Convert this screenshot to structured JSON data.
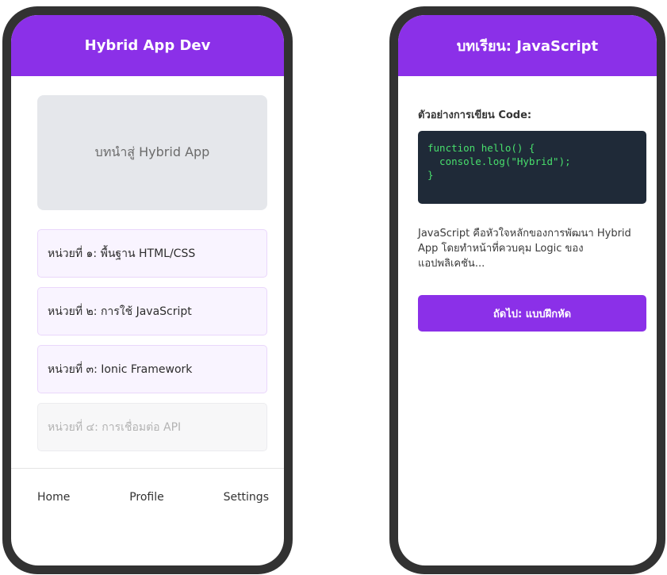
{
  "colors": {
    "accent": "#8b30e8",
    "frame": "#323232",
    "code_bg": "#1f2a38",
    "code_text": "#48df6c"
  },
  "left_screen": {
    "header_title": "Hybrid App Dev",
    "hero_text": "บทนำสู่ Hybrid App",
    "lessons": [
      {
        "label": "หน่วยที่ ๑: พื้นฐาน HTML/CSS",
        "enabled": true
      },
      {
        "label": "หน่วยที่ ๒: การใช้ JavaScript",
        "enabled": true
      },
      {
        "label": "หน่วยที่ ๓: Ionic Framework",
        "enabled": true
      },
      {
        "label": "หน่วยที่ ๔: การเชื่อมต่อ API",
        "enabled": false
      }
    ],
    "nav": {
      "home": "Home",
      "profile": "Profile",
      "settings": "Settings"
    }
  },
  "right_screen": {
    "header_title": "บทเรียน: JavaScript",
    "section_label": "ตัวอย่างการเขียน Code:",
    "code": "function hello() {\n  console.log(\"Hybrid\");\n}",
    "description": "JavaScript คือหัวใจหลักของการพัฒนา Hybrid App โดยทำหน้าที่ควบคุม Logic ของแอปพลิเคชัน...",
    "next_button": "ถัดไป: แบบฝึกหัด"
  }
}
